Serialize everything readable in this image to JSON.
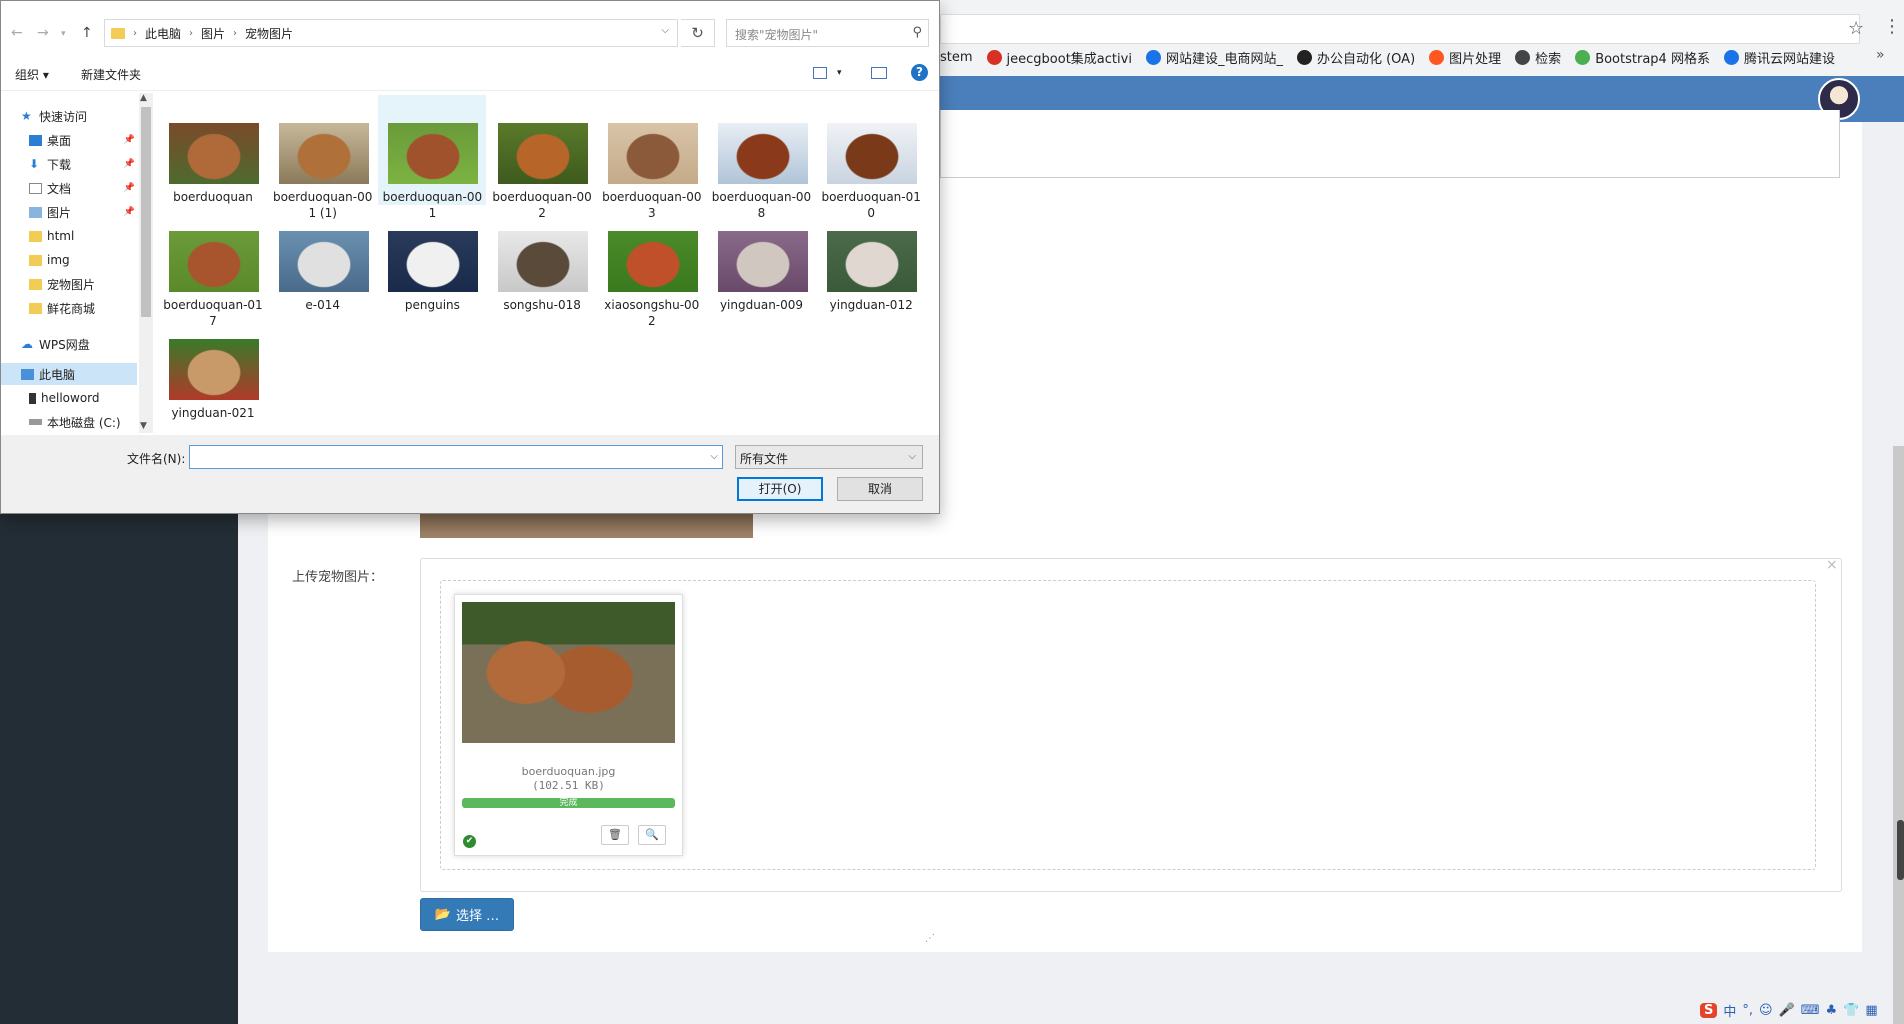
{
  "browser": {
    "bookmarks": [
      {
        "label": "stem",
        "icon": "page-icon",
        "color": "#ffffff"
      },
      {
        "label": "jeecgboot集成activi",
        "icon": "jeecg-icon",
        "color": "#d93025"
      },
      {
        "label": "网站建设_电商网站_",
        "icon": "cloud-icon",
        "color": "#1a73e8"
      },
      {
        "label": "办公自动化 (OA)",
        "icon": "github-icon",
        "color": "#222222"
      },
      {
        "label": "图片处理",
        "icon": "image-tool-icon",
        "color": "#ff5722"
      },
      {
        "label": "检索",
        "icon": "search-tool-icon",
        "color": "#444444"
      },
      {
        "label": "Bootstrap4 网格系",
        "icon": "bootstrap-icon",
        "color": "#4caf50"
      },
      {
        "label": "腾讯云网站建设",
        "icon": "cloud-icon",
        "color": "#1a73e8"
      }
    ]
  },
  "page": {
    "upload_label": "上传宠物图片：",
    "preview": {
      "file_name": "boerduoquan.jpg",
      "file_size": "(102.51 KB)",
      "progress_text": "完成",
      "progress_percent": 100
    },
    "choose_label": "选择 …",
    "tray": [
      "中",
      "°,",
      "☺",
      "🎤",
      "⌨",
      "♣",
      "👕",
      "▦"
    ]
  },
  "dialog": {
    "breadcrumb": [
      "此电脑",
      "图片",
      "宠物图片"
    ],
    "search_placeholder": "搜索\"宠物图片\"",
    "toolbar": {
      "organize": "组织 ▾",
      "new_folder": "新建文件夹"
    },
    "nav": [
      {
        "label": "快速访问",
        "icon": "star-icon",
        "pinned": false,
        "indent": 1
      },
      {
        "label": "桌面",
        "icon": "desktop-icon",
        "pinned": true,
        "indent": 2
      },
      {
        "label": "下载",
        "icon": "download-icon",
        "pinned": true,
        "indent": 2
      },
      {
        "label": "文档",
        "icon": "document-icon",
        "pinned": true,
        "indent": 2
      },
      {
        "label": "图片",
        "icon": "pictures-icon",
        "pinned": true,
        "indent": 2
      },
      {
        "label": "html",
        "icon": "folder-icon",
        "pinned": false,
        "indent": 2
      },
      {
        "label": "img",
        "icon": "folder-icon",
        "pinned": false,
        "indent": 2
      },
      {
        "label": "宠物图片",
        "icon": "folder-icon",
        "pinned": false,
        "indent": 2
      },
      {
        "label": "鲜花商城",
        "icon": "folder-icon",
        "pinned": false,
        "indent": 2
      },
      {
        "label": "WPS网盘",
        "icon": "cloud-icon",
        "pinned": false,
        "indent": 1
      },
      {
        "label": "此电脑",
        "icon": "computer-icon",
        "pinned": false,
        "indent": 1,
        "selected": true
      },
      {
        "label": "helloword",
        "icon": "phone-icon",
        "pinned": false,
        "indent": 2
      },
      {
        "label": "本地磁盘 (C:)",
        "icon": "disk-icon",
        "pinned": false,
        "indent": 2
      }
    ],
    "files": [
      {
        "name": "boerduoquan",
        "colors": [
          "#7a4a2a",
          "#b06a3a",
          "#4e6b2e"
        ]
      },
      {
        "name": "boerduoquan-001 (1)",
        "colors": [
          "#c8b89a",
          "#b0703a",
          "#8a7a5a"
        ]
      },
      {
        "name": "boerduoquan-001",
        "colors": [
          "#6a9a3a",
          "#a0522d",
          "#7cb342"
        ],
        "hover": true
      },
      {
        "name": "boerduoquan-002",
        "colors": [
          "#5a7a2a",
          "#b8652a",
          "#3e5a1e"
        ]
      },
      {
        "name": "boerduoquan-003",
        "colors": [
          "#d9c4a8",
          "#8a5a3a",
          "#c4aa88"
        ]
      },
      {
        "name": "boerduoquan-008",
        "colors": [
          "#e8eef4",
          "#8a3a1a",
          "#b0c4d8"
        ]
      },
      {
        "name": "boerduoquan-010",
        "colors": [
          "#f0f2f6",
          "#7a3a1a",
          "#c8d4e0"
        ]
      },
      {
        "name": "boerduoquan-017",
        "colors": [
          "#6a9a3a",
          "#a8552d",
          "#5a8a2a"
        ]
      },
      {
        "name": "e-014",
        "colors": [
          "#6a90b0",
          "#e0e0e0",
          "#4a6a8a"
        ]
      },
      {
        "name": "penguins",
        "colors": [
          "#2a3a5a",
          "#f0f0f0",
          "#1a2a4a"
        ]
      },
      {
        "name": "songshu-018",
        "colors": [
          "#e8e8e8",
          "#5a4a3a",
          "#c8c8c8"
        ]
      },
      {
        "name": "xiaosongshu-002",
        "colors": [
          "#4a8a2a",
          "#c0502a",
          "#3a7a1e"
        ]
      },
      {
        "name": "yingduan-009",
        "colors": [
          "#8a6a8a",
          "#d0c8c0",
          "#6a4a6a"
        ]
      },
      {
        "name": "yingduan-012",
        "colors": [
          "#4a6a4a",
          "#e0d8d0",
          "#3a5a3a"
        ]
      },
      {
        "name": "yingduan-021",
        "colors": [
          "#3a7a2a",
          "#c89a6a",
          "#b03a2a"
        ]
      }
    ],
    "filename_label": "文件名(N):",
    "filename_value": "",
    "file_type": "所有文件",
    "open_label": "打开(O)",
    "cancel_label": "取消"
  }
}
